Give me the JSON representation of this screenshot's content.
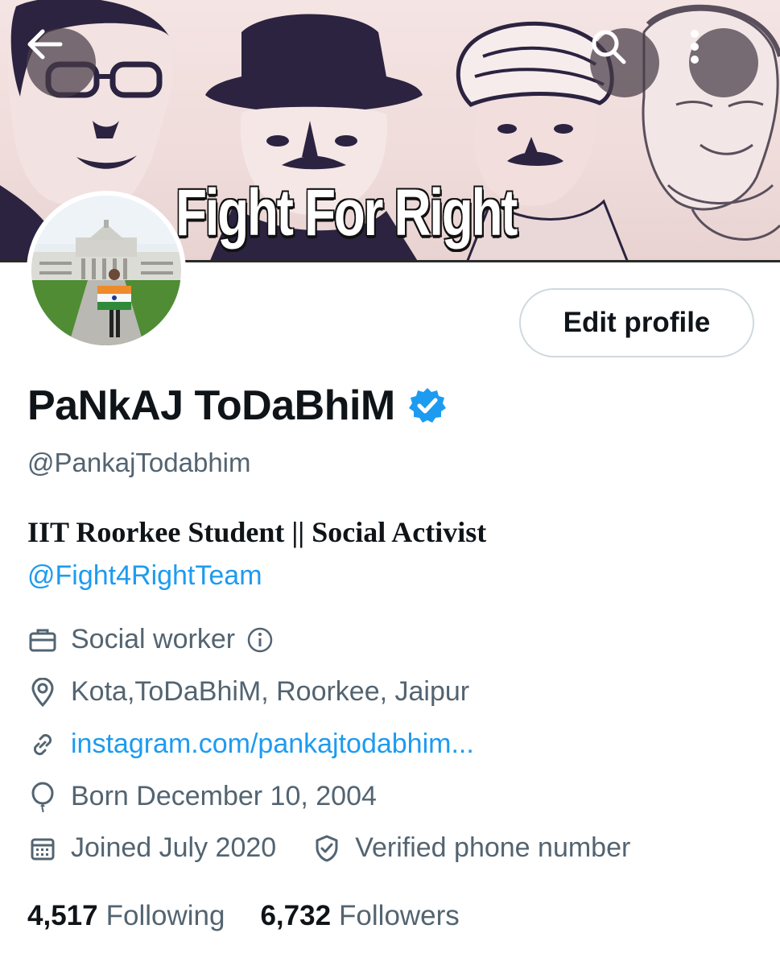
{
  "banner": {
    "slogan": "Fight For Right",
    "icons": {
      "back": "arrow-left-icon",
      "search": "search-icon",
      "more": "more-vertical-icon"
    }
  },
  "profile": {
    "edit_label": "Edit profile",
    "display_name": "PaNkAJ ToDaBhiM",
    "handle": "@PankajTodabhim",
    "bio": "IIT Roorkee Student || Social Activist",
    "bio_mention": "@Fight4RightTeam",
    "profession": "Social worker",
    "location": "Kota,ToDaBhiM, Roorkee, Jaipur",
    "link": "instagram.com/pankajtodabhim...",
    "born": "Born December 10, 2004",
    "joined": "Joined July 2020",
    "verified_phone": "Verified phone number"
  },
  "stats": {
    "following_count": "4,517",
    "following_label": "Following",
    "followers_count": "6,732",
    "followers_label": "Followers"
  },
  "colors": {
    "accent": "#1d9bf0",
    "text": "#0f1419",
    "secondary": "#536471",
    "border": "#cfd9de"
  }
}
